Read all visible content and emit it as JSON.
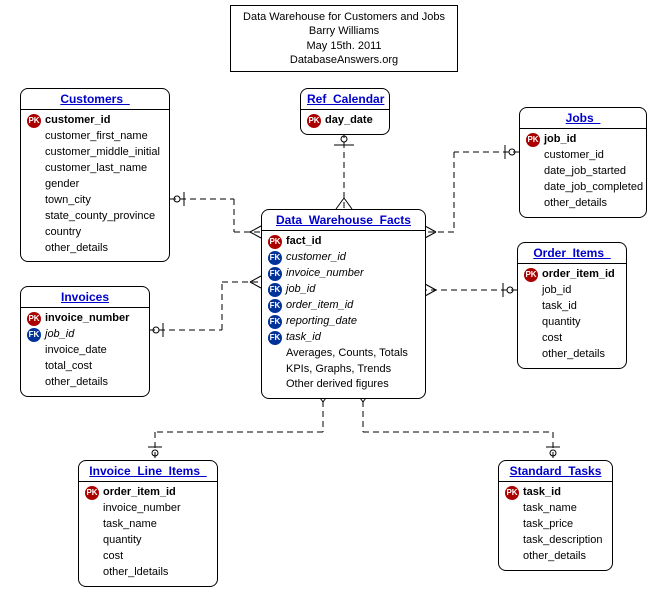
{
  "title": {
    "line1": "Data Warehouse for Customers and Jobs",
    "line2": "Barry Williams",
    "line3": "May 15th. 2011",
    "line4": "DatabaseAnswers.org"
  },
  "entities": {
    "customers": {
      "name": "Customers_",
      "attrs": [
        {
          "key": "PK",
          "label": "customer_id",
          "bold": true
        },
        {
          "key": "",
          "label": "customer_first_name"
        },
        {
          "key": "",
          "label": "customer_middle_initial"
        },
        {
          "key": "",
          "label": "customer_last_name"
        },
        {
          "key": "",
          "label": "gender"
        },
        {
          "key": "",
          "label": "town_city"
        },
        {
          "key": "",
          "label": "state_county_province"
        },
        {
          "key": "",
          "label": "country"
        },
        {
          "key": "",
          "label": "other_details"
        }
      ]
    },
    "ref_calendar": {
      "name": "Ref_Calendar",
      "attrs": [
        {
          "key": "PK",
          "label": "day_date",
          "bold": true
        }
      ]
    },
    "jobs": {
      "name": "Jobs_",
      "attrs": [
        {
          "key": "PK",
          "label": "job_id",
          "bold": true
        },
        {
          "key": "",
          "label": "customer_id"
        },
        {
          "key": "",
          "label": "date_job_started"
        },
        {
          "key": "",
          "label": "date_job_completed"
        },
        {
          "key": "",
          "label": "other_details"
        }
      ]
    },
    "facts": {
      "name": "Data_Warehouse_Facts",
      "attrs": [
        {
          "key": "PK",
          "label": "fact_id",
          "bold": true
        },
        {
          "key": "FK",
          "label": "customer_id",
          "italic": true
        },
        {
          "key": "FK",
          "label": "invoice_number",
          "italic": true
        },
        {
          "key": "FK",
          "label": "job_id",
          "italic": true
        },
        {
          "key": "FK",
          "label": "order_item_id",
          "italic": true
        },
        {
          "key": "FK",
          "label": "reporting_date",
          "italic": true
        },
        {
          "key": "FK",
          "label": "task_id",
          "italic": true
        },
        {
          "key": "",
          "label": "Averages, Counts, Totals"
        },
        {
          "key": "",
          "label": "KPIs, Graphs, Trends"
        },
        {
          "key": "",
          "label": "Other derived figures"
        }
      ]
    },
    "invoices": {
      "name": "Invoices",
      "attrs": [
        {
          "key": "PK",
          "label": "invoice_number",
          "bold": true
        },
        {
          "key": "FK",
          "label": "job_id",
          "italic": true
        },
        {
          "key": "",
          "label": "invoice_date"
        },
        {
          "key": "",
          "label": "total_cost"
        },
        {
          "key": "",
          "label": "other_details"
        }
      ]
    },
    "order_items": {
      "name": "Order_Items_",
      "attrs": [
        {
          "key": "PK",
          "label": "order_item_id",
          "bold": true
        },
        {
          "key": "",
          "label": "job_id"
        },
        {
          "key": "",
          "label": "task_id"
        },
        {
          "key": "",
          "label": "quantity"
        },
        {
          "key": "",
          "label": "cost"
        },
        {
          "key": "",
          "label": "other_details"
        }
      ]
    },
    "invoice_line_items": {
      "name": "Invoice_Line_Items_",
      "attrs": [
        {
          "key": "PK",
          "label": "order_item_id",
          "bold": true
        },
        {
          "key": "",
          "label": "invoice_number"
        },
        {
          "key": "",
          "label": "task_name"
        },
        {
          "key": "",
          "label": "quantity"
        },
        {
          "key": "",
          "label": "cost"
        },
        {
          "key": "",
          "label": "other_ldetails"
        }
      ]
    },
    "standard_tasks": {
      "name": "Standard_Tasks",
      "attrs": [
        {
          "key": "PK",
          "label": "task_id",
          "bold": true
        },
        {
          "key": "",
          "label": "task_name"
        },
        {
          "key": "",
          "label": "task_price"
        },
        {
          "key": "",
          "label": "task_description"
        },
        {
          "key": "",
          "label": "other_details"
        }
      ]
    }
  }
}
